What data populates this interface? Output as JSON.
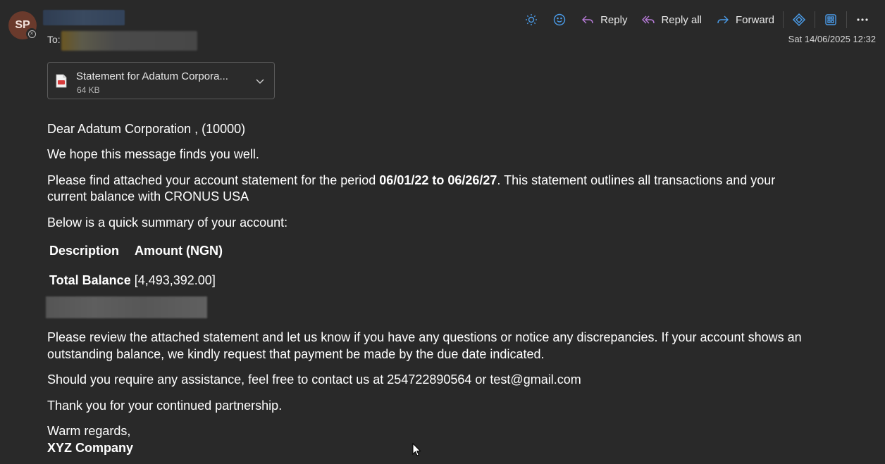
{
  "header": {
    "avatar_initials": "SP",
    "to_label": "To:",
    "timestamp": "Sat 14/06/2025 12:32"
  },
  "toolbar": {
    "reply_label": "Reply",
    "reply_all_label": "Reply all",
    "forward_label": "Forward",
    "icons": [
      "brightness-icon",
      "emoji-icon",
      "reply-icon",
      "reply-all-icon",
      "forward-icon",
      "copilot-icon",
      "apps-icon",
      "more-icon"
    ]
  },
  "attachment": {
    "name": "Statement for Adatum Corpora...",
    "size": "64 KB"
  },
  "email": {
    "greeting": "Dear Adatum Corporation , (10000)",
    "hope_line": "We hope this message finds you well.",
    "period_prefix": "Please find attached your account statement for the period ",
    "period_dates": "06/01/22 to 06/26/27",
    "period_suffix": ". This statement outlines all transactions and your",
    "period_line2": "current balance with CRONUS USA",
    "summary_intro": "Below is a quick summary of your account:",
    "table": {
      "col_description": "Description",
      "col_amount": "Amount (NGN)",
      "total_label": "Total Balance",
      "total_value": "[4,493,392.00]"
    },
    "review_line1": "Please review the attached statement and let us know if you have any questions or notice any discrepancies. If your account shows an",
    "review_line2": "outstanding balance, we kindly request that payment be made by the due date indicated.",
    "contact_line": "Should you require any assistance, feel free to contact us at 254722890564 or test@gmail.com",
    "thanks_line": "Thank you for your continued partnership.",
    "regards": "Warm regards,",
    "company": "XYZ Company"
  },
  "colors": {
    "background": "#292929",
    "toolbar_icon_blue": "#4a9be8",
    "reply_all_purple": "#b57ad6",
    "avatar_bg": "#6a3a2c"
  }
}
